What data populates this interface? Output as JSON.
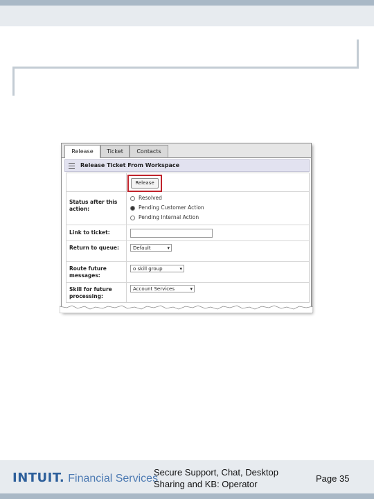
{
  "screenshot": {
    "tabs": [
      {
        "label": "Release",
        "active": true
      },
      {
        "label": "Ticket",
        "active": false
      },
      {
        "label": "Contacts",
        "active": false
      }
    ],
    "panel_title": "Release Ticket From Workspace",
    "release_button_label": "Release",
    "fields": {
      "status_label": "Status after this action:",
      "status_options": [
        {
          "label": "Resolved",
          "selected": false
        },
        {
          "label": "Pending Customer Action",
          "selected": true
        },
        {
          "label": "Pending Internal Action",
          "selected": false
        }
      ],
      "link_label": "Link to ticket:",
      "link_value": "",
      "queue_label": "Return to queue:",
      "queue_value": "Default",
      "route_label": "Route future messages:",
      "route_value": "o skill group",
      "skill_label": "Skill for future processing:",
      "skill_value": "Account Services"
    },
    "highlight_color": "#c0232b"
  },
  "footer": {
    "brand": "INTUIT.",
    "brand_sub": "Financial Services",
    "title_line1": "Secure Support, Chat, Desktop",
    "title_line2": "Sharing and KB: Operator",
    "page": "Page 35"
  },
  "icons": {
    "panel_icon": "collapse-icon",
    "dropdown_icon": "chevron-down-icon"
  }
}
